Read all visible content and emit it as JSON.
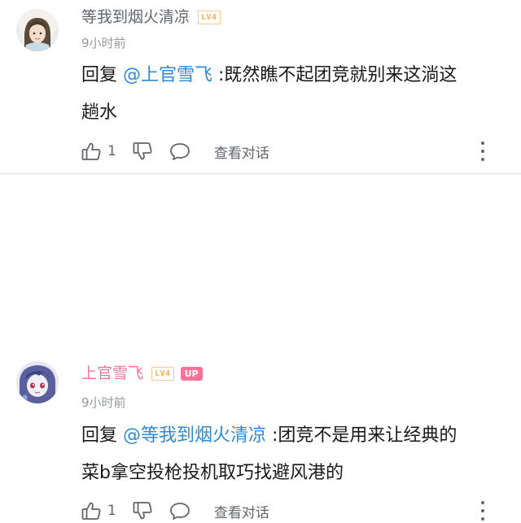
{
  "comments": [
    {
      "username": "等我到烟火清凉",
      "level": "LV4",
      "is_up": false,
      "time": "9小时前",
      "reply_prefix": "回复 ",
      "mention": "@上官雪飞",
      "body_line1": " :既然瞧不起团竞就别来这淌这",
      "body_line2": "趟水",
      "likes": "1",
      "view_conversation": "查看对话",
      "avatar_icon": "avatar-girl-icon"
    },
    {
      "username": "上官雪飞",
      "level": "LV4",
      "is_up": true,
      "up_badge": "UP",
      "time": "9小时前",
      "reply_prefix": "回复 ",
      "mention": "@等我到烟火清凉",
      "body_line1": " :团竞不是用来让经典的",
      "body_line2": "菜b拿空投枪投机取巧找避风港的",
      "likes": "1",
      "view_conversation": "查看对话",
      "avatar_icon": "avatar-anime-icon"
    }
  ],
  "colors": {
    "mention": "#2e8ad6",
    "up_name": "#fb7299",
    "level_badge": "#ffb146",
    "meta": "#9499a0"
  }
}
